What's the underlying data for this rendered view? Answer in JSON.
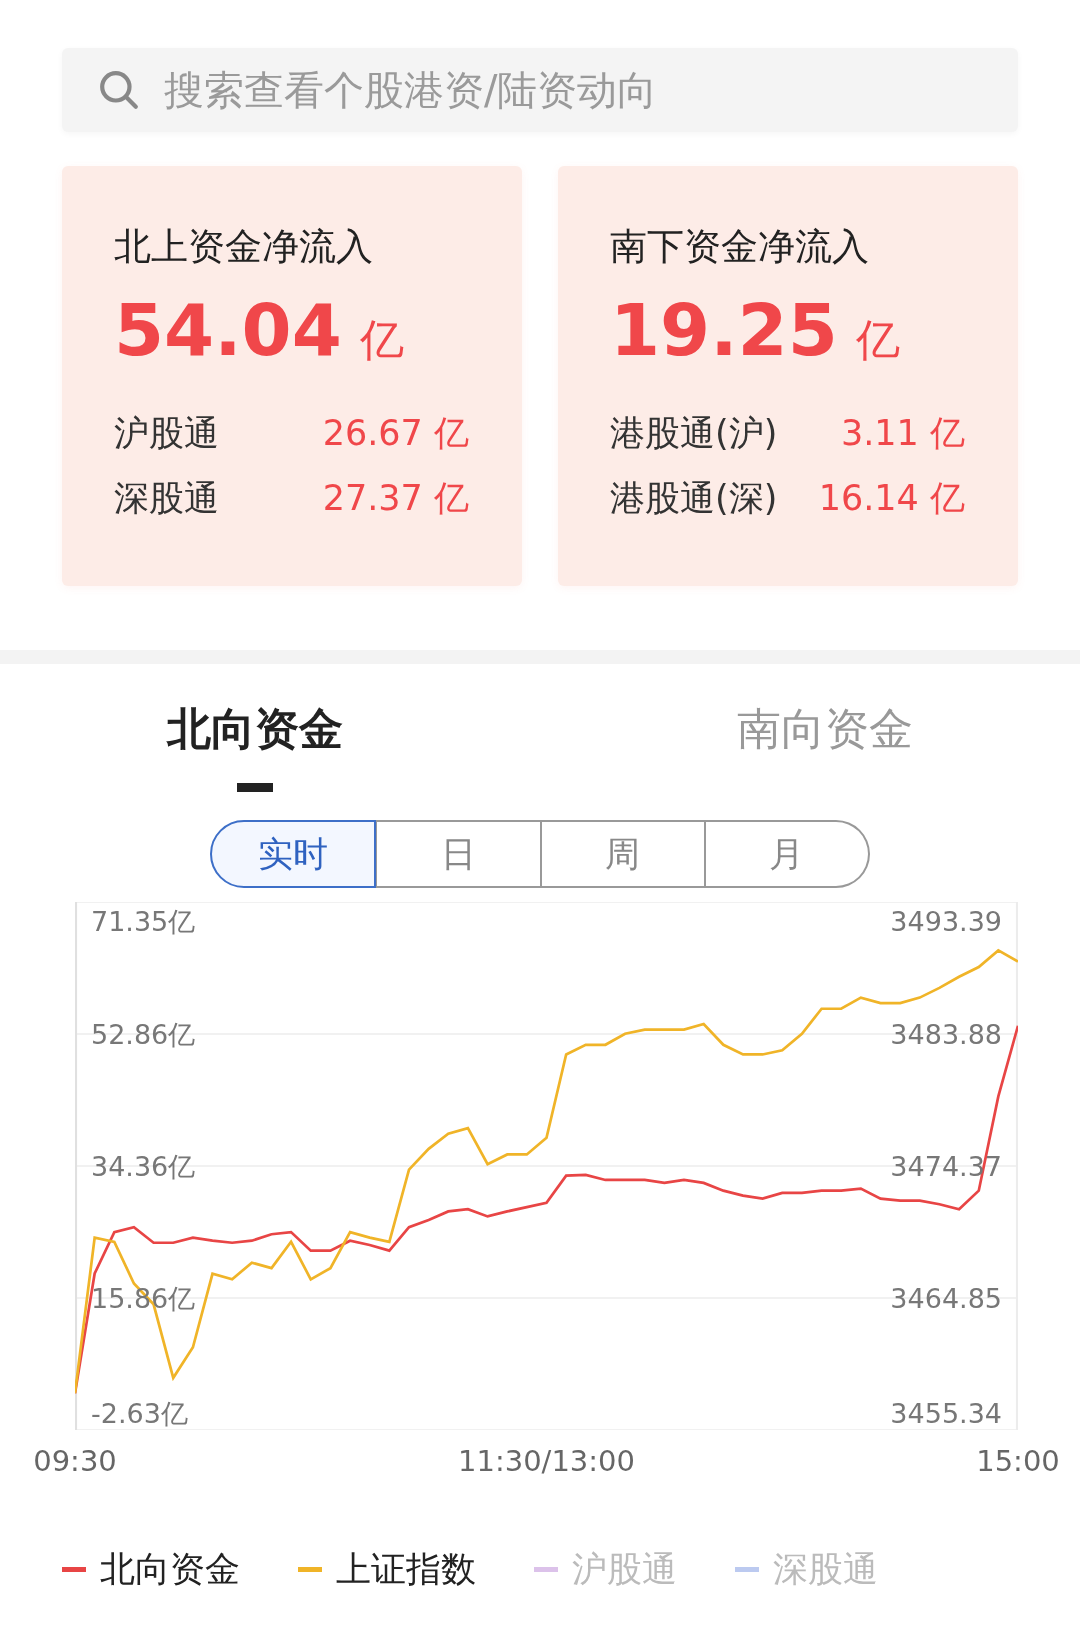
{
  "search": {
    "placeholder": "搜索查看个股港资/陆资动向"
  },
  "cards": [
    {
      "title": "北上资金净流入",
      "amount": "54.04",
      "unit": "亿",
      "rows": [
        {
          "label": "沪股通",
          "value": "26.67",
          "unit": "亿"
        },
        {
          "label": "深股通",
          "value": "27.37",
          "unit": "亿"
        }
      ]
    },
    {
      "title": "南下资金净流入",
      "amount": "19.25",
      "unit": "亿",
      "rows": [
        {
          "label": "港股通(沪)",
          "value": "3.11",
          "unit": "亿"
        },
        {
          "label": "港股通(深)",
          "value": "16.14",
          "unit": "亿"
        }
      ]
    }
  ],
  "tabs": [
    {
      "label": "北向资金",
      "selected": true
    },
    {
      "label": "南向资金",
      "selected": false
    }
  ],
  "periods": [
    {
      "label": "实时",
      "selected": true
    },
    {
      "label": "日",
      "selected": false
    },
    {
      "label": "周",
      "selected": false
    },
    {
      "label": "月",
      "selected": false
    }
  ],
  "chart": {
    "chart_data": {
      "type": "line",
      "ylim": [
        -2.63,
        71.35
      ],
      "y2lim": [
        3455.34,
        3493.39
      ],
      "grid": true,
      "categories": [
        "09:30",
        null,
        null,
        null,
        null,
        null,
        null,
        null,
        null,
        null,
        null,
        null,
        null,
        null,
        null,
        null,
        null,
        null,
        null,
        null,
        null,
        null,
        null,
        null,
        "11:30/13:00",
        null,
        null,
        null,
        null,
        null,
        null,
        null,
        null,
        null,
        null,
        null,
        null,
        null,
        null,
        null,
        null,
        null,
        null,
        null,
        null,
        null,
        null,
        null,
        "15:00"
      ],
      "yticks": [
        {
          "value": 71.35,
          "label": "71.35亿"
        },
        {
          "value": 52.86,
          "label": "52.86亿"
        },
        {
          "value": 34.36,
          "label": "34.36亿"
        },
        {
          "value": 15.86,
          "label": "15.86亿"
        },
        {
          "value": -2.63,
          "label": "-2.63亿"
        }
      ],
      "y2ticks": [
        {
          "value": 3493.39,
          "label": "3493.39"
        },
        {
          "value": 3483.88,
          "label": "3483.88"
        },
        {
          "value": 3474.37,
          "label": "3474.37"
        },
        {
          "value": 3464.85,
          "label": "3464.85"
        },
        {
          "value": 3455.34,
          "label": "3455.34"
        }
      ],
      "series": [
        {
          "name": "北向资金",
          "color": "#e84545",
          "values": [
            2.5,
            19.3,
            25.1,
            25.8,
            23.6,
            23.6,
            24.3,
            23.9,
            23.6,
            23.9,
            24.8,
            25.1,
            22.5,
            22.5,
            23.9,
            23.3,
            22.5,
            25.8,
            26.8,
            28.0,
            28.3,
            27.3,
            28.0,
            28.6,
            29.2,
            33.0,
            33.1,
            32.4,
            32.4,
            32.4,
            32.0,
            32.4,
            32.0,
            30.9,
            30.2,
            29.8,
            30.6,
            30.6,
            30.9,
            30.9,
            31.2,
            29.8,
            29.5,
            29.5,
            29.0,
            28.3,
            30.9,
            44.1,
            54.0
          ]
        },
        {
          "name": "上证指数",
          "color": "#f0b428",
          "axis": "y2",
          "values": [
            3458.0,
            3469.2,
            3468.9,
            3465.9,
            3464.4,
            3459.1,
            3461.3,
            3466.6,
            3466.2,
            3467.4,
            3467.0,
            3468.9,
            3466.2,
            3467.0,
            3469.6,
            3469.2,
            3468.9,
            3474.1,
            3475.6,
            3476.7,
            3477.1,
            3474.5,
            3475.2,
            3475.2,
            3476.4,
            3482.4,
            3483.1,
            3483.1,
            3483.9,
            3484.2,
            3484.2,
            3484.2,
            3484.6,
            3483.1,
            3482.4,
            3482.4,
            3482.7,
            3483.9,
            3485.7,
            3485.7,
            3486.5,
            3486.1,
            3486.1,
            3486.5,
            3487.2,
            3488.0,
            3488.7,
            3489.9,
            3489.1
          ]
        }
      ]
    }
  },
  "legend_extra": [
    {
      "label": "沪股通",
      "color": "#dcc2ea",
      "active": false
    },
    {
      "label": "深股通",
      "color": "#bccaf0",
      "active": false
    }
  ]
}
